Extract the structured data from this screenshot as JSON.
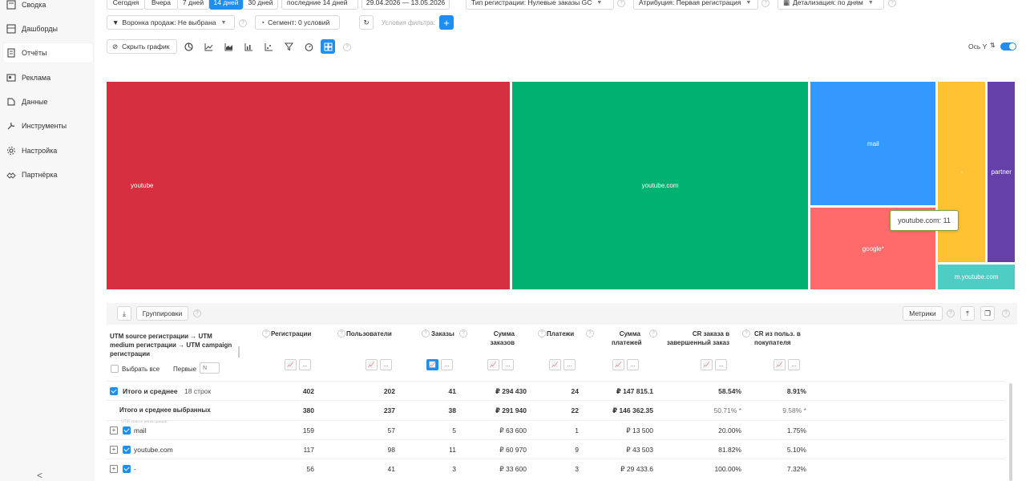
{
  "sidebar": {
    "items": [
      {
        "label": "Сводка",
        "icon": "summary-icon"
      },
      {
        "label": "Дашборды",
        "icon": "dashboard-icon"
      },
      {
        "label": "Отчёты",
        "icon": "reports-icon"
      },
      {
        "label": "Реклама",
        "icon": "ads-icon"
      },
      {
        "label": "Данные",
        "icon": "data-icon"
      },
      {
        "label": "Инструменты",
        "icon": "tools-icon"
      },
      {
        "label": "Настройка",
        "icon": "settings-icon"
      },
      {
        "label": "Партнёрка",
        "icon": "partner-icon"
      }
    ],
    "collapse": "<"
  },
  "filters": {
    "periods": [
      "Сегодня",
      "Вчера",
      "7 дней",
      "14 дней",
      "30 дней"
    ],
    "active_period": "14 дней",
    "last_n": "последние 14 дней",
    "date_range": "29.04.2026  —  13.05.2026",
    "registration_type": "Тип регистрации: Нулевые заказы GC",
    "attribution": "Атрибуция: Первая регистрация",
    "detail": "Детализация: по дням",
    "funnel": "Воронка продаж: Не выбрана",
    "segment": "Сегмент: 0 условий",
    "filter_conditions": "Условия фильтра:"
  },
  "chart_toolbar": {
    "hide_chart": "Скрыть график",
    "axis_y": "Ось Y"
  },
  "chart_data": {
    "type": "treemap",
    "items": [
      {
        "label": "youtube",
        "value": 159,
        "color": "#d62f3f"
      },
      {
        "label": "youtube.com",
        "value": 117,
        "color": "#00b171"
      },
      {
        "label": "mail",
        "value": 30,
        "color": "#3399ff"
      },
      {
        "label": "google*",
        "value": 20,
        "color": "#ff6b6b"
      },
      {
        "label": "-",
        "value": 17,
        "color": "#ffc233"
      },
      {
        "label": "partner",
        "value": 10,
        "color": "#6440a8"
      },
      {
        "label": "m.youtube.com",
        "value": 4,
        "color": "#4ecdc4"
      }
    ],
    "tooltip": "youtube.com: 11"
  },
  "table_toolbar": {
    "groupings": "Группировки",
    "metrics": "Метрики"
  },
  "table": {
    "group_header": "UTM source регистрации → UTM medium регистрации → UTM campaign регистрации",
    "select_all": "Выбрать все",
    "first": "Первые",
    "first_placeholder": "N",
    "sublabel": "UTM source регистрации",
    "columns": [
      "Регистрации",
      "Пользователи",
      "Заказы",
      "Сумма заказов",
      "Платежи",
      "Сумма платежей",
      "CR заказа в завершенный заказ",
      "CR из польз. в покупателя"
    ],
    "total": {
      "label": "Итого и среднее",
      "count": "18 строк",
      "values": [
        "402",
        "202",
        "41",
        "₽ 294 430",
        "24",
        "₽ 147 815.1",
        "58.54%",
        "8.91%"
      ]
    },
    "selected": {
      "label": "Итого и среднее выбранных",
      "values": [
        "380",
        "237",
        "38",
        "₽ 291 940",
        "22",
        "₽ 146 362.35",
        "50.71% *",
        "9.58% *"
      ]
    },
    "rows": [
      {
        "label": "mail",
        "values": [
          "159",
          "57",
          "5",
          "₽ 63 600",
          "1",
          "₽ 13 500",
          "20.00%",
          "1.75%"
        ]
      },
      {
        "label": "youtube.com",
        "values": [
          "117",
          "98",
          "11",
          "₽ 60 970",
          "9",
          "₽ 43 503",
          "81.82%",
          "5.10%"
        ]
      },
      {
        "label": "-",
        "values": [
          "56",
          "41",
          "3",
          "₽ 33 600",
          "3",
          "₽ 29 433.6",
          "100.00%",
          "7.32%"
        ]
      }
    ]
  }
}
